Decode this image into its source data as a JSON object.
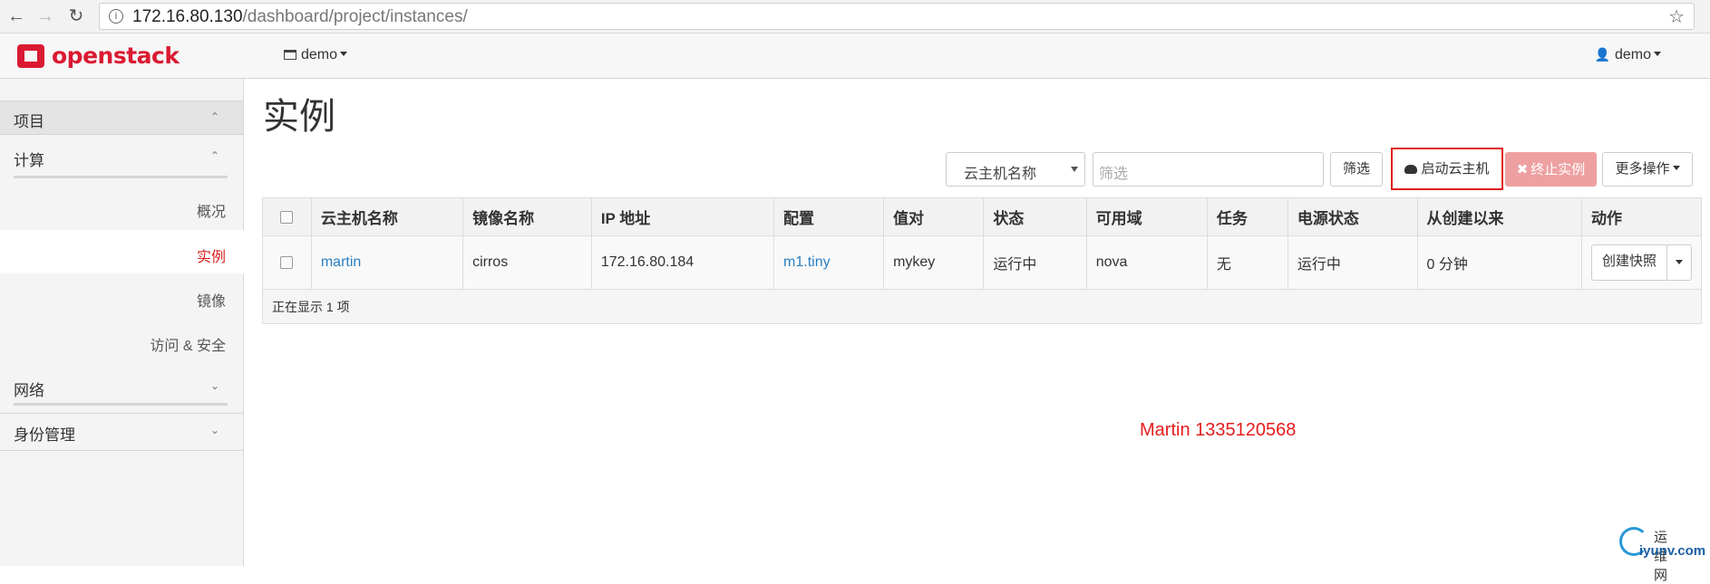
{
  "browser": {
    "url_host": "172.16.80.130",
    "url_path": "/dashboard/project/instances/"
  },
  "topnav": {
    "logo_text": "openstack",
    "project_selector": "demo",
    "user_menu": "demo"
  },
  "sidebar": {
    "project": "项目",
    "compute": "计算",
    "compute_items": [
      "概况",
      "实例",
      "镜像",
      "访问 & 安全"
    ],
    "active_item": "实例",
    "network": "网络",
    "identity": "身份管理"
  },
  "page": {
    "title": "实例"
  },
  "toolbar": {
    "filter_field": "云主机名称",
    "filter_placeholder": "筛选",
    "filter_button": "筛选",
    "launch_button": "启动云主机",
    "terminate_button": "终止实例",
    "more_button": "更多操作"
  },
  "table": {
    "columns": [
      "云主机名称",
      "镜像名称",
      "IP 地址",
      "配置",
      "值对",
      "状态",
      "可用域",
      "任务",
      "电源状态",
      "从创建以来",
      "动作"
    ],
    "rows": [
      {
        "name": "martin",
        "image": "cirros",
        "ip": "172.16.80.184",
        "flavor": "m1.tiny",
        "keypair": "mykey",
        "status": "运行中",
        "zone": "nova",
        "task": "无",
        "power": "运行中",
        "age": "0 分钟",
        "action": "创建快照"
      }
    ],
    "footer": "正在显示 1 项"
  },
  "watermark": "Martin 1335120568",
  "brand": {
    "cn": "运维网",
    "domain": "iyunv.com"
  },
  "colors": {
    "accent_red": "#da1a32",
    "link_blue": "#2a7fc1",
    "danger_button": "#eea0a1",
    "highlight_box": "#e21b1b"
  }
}
